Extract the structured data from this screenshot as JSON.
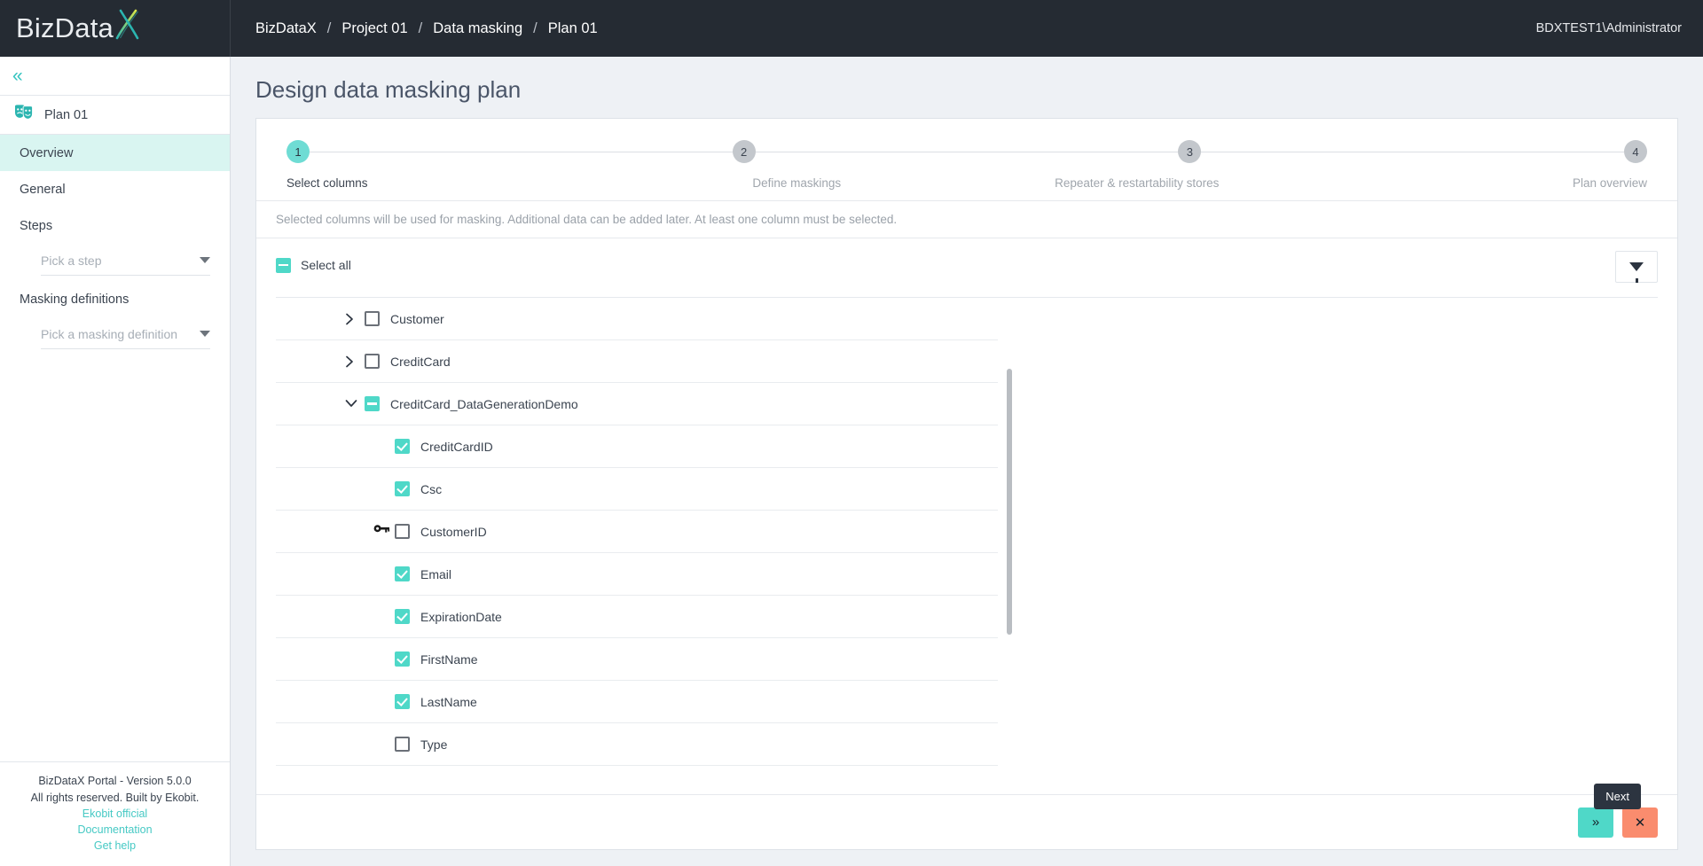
{
  "brand": {
    "logo_text": "BizData",
    "logo_accent": "X",
    "accent_color": "#4fd8c8",
    "dark_color": "#252b33"
  },
  "topbar": {
    "breadcrumb": [
      "BizDataX",
      "Project 01",
      "Data masking",
      "Plan 01"
    ],
    "separator": "/",
    "user": "BDXTEST1\\Administrator"
  },
  "sidebar": {
    "collapse_icon": "double-chevron-left-icon",
    "plan": {
      "icon": "theater-masks-icon",
      "label": "Plan 01"
    },
    "items": [
      {
        "label": "Overview",
        "active": true
      },
      {
        "label": "General",
        "active": false
      },
      {
        "label": "Steps",
        "active": false
      }
    ],
    "step_picker": {
      "placeholder": "Pick a step",
      "value": ""
    },
    "masking_definitions_label": "Masking definitions",
    "masking_picker": {
      "placeholder": "Pick a masking definition",
      "value": ""
    },
    "footer": {
      "version": "BizDataX Portal - Version 5.0.0",
      "rights": "All rights reserved. Built by Ekobit.",
      "links": [
        "Ekobit official",
        "Documentation",
        "Get help"
      ]
    }
  },
  "main": {
    "page_title": "Design data masking plan",
    "stepper": [
      {
        "number": "1",
        "label": "Select columns",
        "active": true
      },
      {
        "number": "2",
        "label": "Define maskings",
        "active": false
      },
      {
        "number": "3",
        "label": "Repeater & restartability stores",
        "active": false
      },
      {
        "number": "4",
        "label": "Plan overview",
        "active": false
      }
    ],
    "info_text": "Selected columns will be used for masking. Additional data can be added later. At least one column must be selected.",
    "select_all": {
      "label": "Select all",
      "state": "indeterminate"
    },
    "filter_button": "filter-icon",
    "tree": [
      {
        "type": "group",
        "label": "Customer",
        "expanded": false,
        "state": "empty"
      },
      {
        "type": "group",
        "label": "CreditCard",
        "expanded": false,
        "state": "empty"
      },
      {
        "type": "group",
        "label": "CreditCard_DataGenerationDemo",
        "expanded": true,
        "state": "indeterminate"
      },
      {
        "type": "leaf",
        "label": "CreditCardID",
        "state": "checked",
        "key": false
      },
      {
        "type": "leaf",
        "label": "Csc",
        "state": "checked",
        "key": false
      },
      {
        "type": "leaf",
        "label": "CustomerID",
        "state": "empty",
        "key": true
      },
      {
        "type": "leaf",
        "label": "Email",
        "state": "checked",
        "key": false
      },
      {
        "type": "leaf",
        "label": "ExpirationDate",
        "state": "checked",
        "key": false
      },
      {
        "type": "leaf",
        "label": "FirstName",
        "state": "checked",
        "key": false
      },
      {
        "type": "leaf",
        "label": "LastName",
        "state": "checked",
        "key": false
      },
      {
        "type": "leaf",
        "label": "Type",
        "state": "empty",
        "key": false
      }
    ],
    "actions": {
      "tooltip": "Next",
      "next_icon": "double-chevron-right-icon",
      "next_glyph": "»",
      "cancel_icon": "close-icon",
      "cancel_glyph": "✕"
    }
  }
}
